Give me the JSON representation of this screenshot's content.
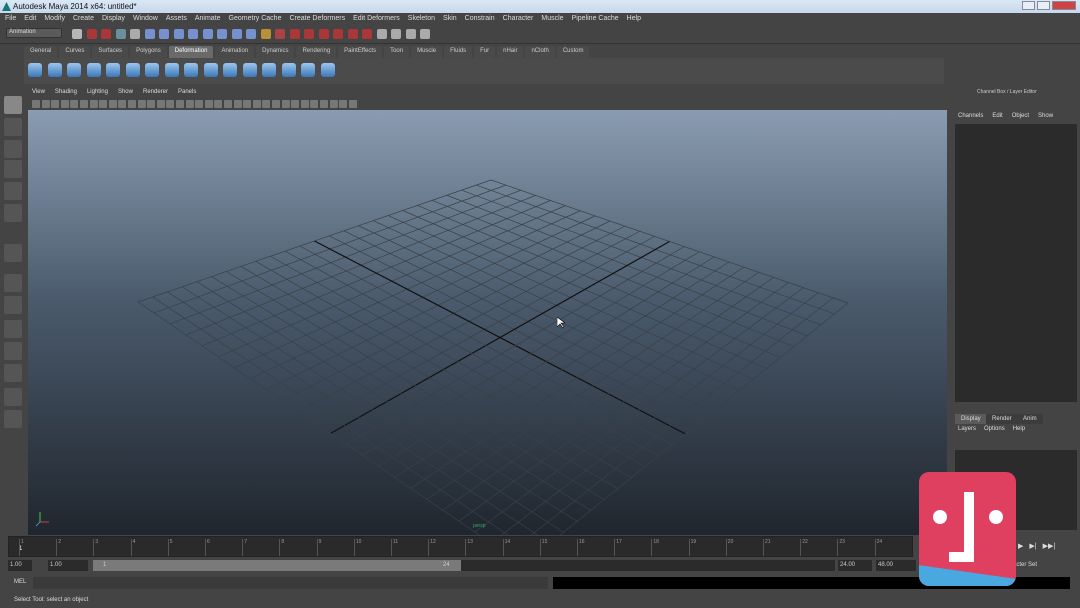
{
  "window": {
    "title": "Autodesk Maya 2014 x64: untitled*"
  },
  "menubar": [
    "File",
    "Edit",
    "Modify",
    "Create",
    "Display",
    "Window",
    "Assets",
    "Animate",
    "Geometry Cache",
    "Create Deformers",
    "Edit Deformers",
    "Skeleton",
    "Skin",
    "Constrain",
    "Character",
    "Muscle",
    "Pipeline Cache",
    "Help"
  ],
  "toolbar": {
    "mode": "Animation"
  },
  "shelf": {
    "tabs": [
      "General",
      "Curves",
      "Surfaces",
      "Polygons",
      "Deformation",
      "Animation",
      "Dynamics",
      "Rendering",
      "PaintEffects",
      "Toon",
      "Muscle",
      "Fluids",
      "Fur",
      "nHair",
      "nCloth",
      "Custom"
    ],
    "active": "Deformation"
  },
  "panel": {
    "menu": [
      "View",
      "Shading",
      "Lighting",
      "Show",
      "Renderer",
      "Panels"
    ]
  },
  "viewport": {
    "camera_label": "persp",
    "background_top": "#8a9cb1",
    "background_bottom": "#20262e"
  },
  "channel_box": {
    "title": "Channel Box / Layer Editor",
    "menu": [
      "Channels",
      "Edit",
      "Object",
      "Show"
    ]
  },
  "layer_editor": {
    "tabs": [
      "Display",
      "Render",
      "Anim"
    ],
    "active": "Display",
    "menu": [
      "Layers",
      "Options",
      "Help"
    ]
  },
  "time_slider": {
    "ticks": [
      "1",
      "2",
      "3",
      "4",
      "5",
      "6",
      "7",
      "8",
      "9",
      "10",
      "11",
      "12",
      "13",
      "14",
      "15",
      "16",
      "17",
      "18",
      "19",
      "20",
      "21",
      "22",
      "23",
      "24"
    ],
    "current": "1"
  },
  "range": {
    "start": "1.00",
    "playback_start": "1.00",
    "slider_start": "1",
    "slider_end": "24",
    "playback_end": "24.00",
    "end": "48.00",
    "character_set": "Character Set"
  },
  "command_line": {
    "label": "MEL"
  },
  "status_line": {
    "text": "Select Tool: select an object"
  }
}
